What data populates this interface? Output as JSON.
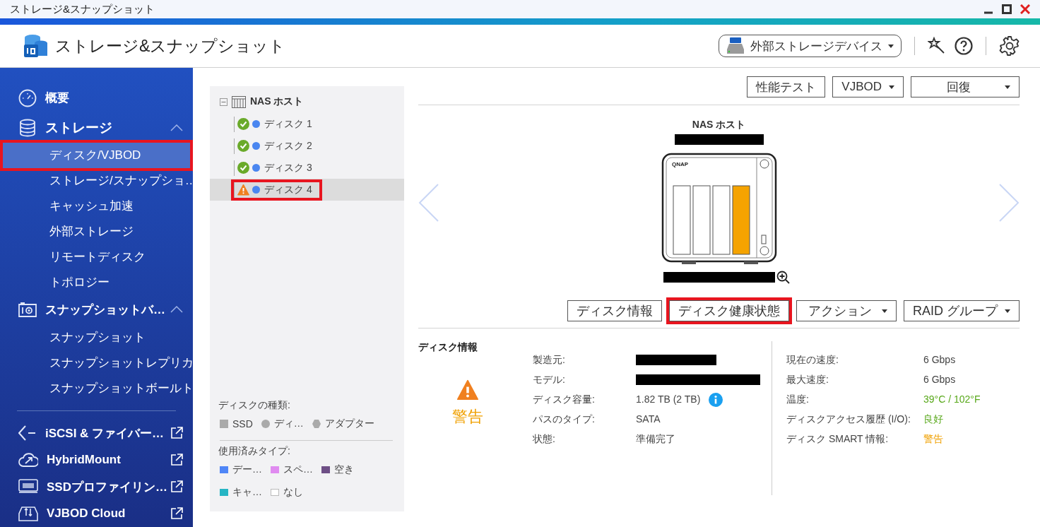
{
  "window": {
    "title": "ストレージ&スナップショット"
  },
  "header": {
    "app_title": "ストレージ&スナップショット",
    "device_selector": "外部ストレージデバイス"
  },
  "sidebar": {
    "sections": [
      {
        "label": "概要"
      },
      {
        "label": "ストレージ",
        "expanded": true,
        "children": [
          {
            "label": "ディスク/VJBOD",
            "selected": true,
            "highlighted": true
          },
          {
            "label": "ストレージ/スナップショ…",
            "selected": false,
            "highlighted": false
          },
          {
            "label": "キャッシュ加速",
            "selected": false,
            "highlighted": false
          },
          {
            "label": "外部ストレージ",
            "selected": false,
            "highlighted": false
          },
          {
            "label": "リモートディスク",
            "selected": false,
            "highlighted": false
          },
          {
            "label": "トポロジー",
            "selected": false,
            "highlighted": false
          }
        ]
      },
      {
        "label": "スナップショットバ…",
        "expanded": true,
        "children": [
          {
            "label": "スナップショット",
            "selected": false,
            "highlighted": false
          },
          {
            "label": "スナップショットレプリカ",
            "selected": false,
            "highlighted": false
          },
          {
            "label": "スナップショットボールト",
            "selected": false,
            "highlighted": false
          }
        ]
      }
    ],
    "external_links": [
      {
        "label": "iSCSI & ファイバー…"
      },
      {
        "label": "HybridMount"
      },
      {
        "label": "SSDプロファイリン…"
      },
      {
        "label": "VJBOD Cloud"
      }
    ]
  },
  "tree": {
    "label": "NAS ホスト",
    "expanded": true,
    "children": [
      {
        "label": "ディスク 1",
        "warning": false,
        "selected": false,
        "highlighted": false
      },
      {
        "label": "ディスク 2",
        "warning": false,
        "selected": false,
        "highlighted": false
      },
      {
        "label": "ディスク 3",
        "warning": false,
        "selected": false,
        "highlighted": false
      },
      {
        "label": "ディスク 4",
        "warning": true,
        "selected": true,
        "highlighted": true
      }
    ]
  },
  "legend": {
    "disk_types_title": "ディスクの種類:",
    "disk_types": [
      {
        "label": "SSD",
        "kind": "square"
      },
      {
        "label": "ディ…",
        "kind": "circle"
      },
      {
        "label": "アダプター",
        "kind": "hexagon"
      }
    ],
    "usage_types_title": "使用済みタイプ:",
    "usage_types": [
      {
        "label": "デー…",
        "color": "#4f86f7"
      },
      {
        "label": "スペ…",
        "color": "#e08bf0"
      },
      {
        "label": "空き",
        "color": "#6e4f86"
      },
      {
        "label": "キャ…",
        "color": "#26b5c4"
      },
      {
        "label": "なし",
        "color": "#ffffff"
      }
    ]
  },
  "toolbar": [
    {
      "label": "性能テスト",
      "kind": "button"
    },
    {
      "label": "VJBOD",
      "kind": "dropdown"
    },
    {
      "label": "回復",
      "kind": "dropdown"
    }
  ],
  "device": {
    "title": "NAS ホスト",
    "brand": "QNAP",
    "slots": [
      {
        "warning": false
      },
      {
        "warning": false
      },
      {
        "warning": false
      },
      {
        "warning": true
      }
    ]
  },
  "actions": [
    {
      "label": "ディスク情報",
      "kind": "button",
      "highlighted": false
    },
    {
      "label": "ディスク健康状態",
      "kind": "button",
      "highlighted": true
    },
    {
      "label": "アクション",
      "kind": "dropdown",
      "highlighted": false
    },
    {
      "label": "RAID グループ",
      "kind": "dropdown",
      "highlighted": false
    }
  ],
  "disk_info": {
    "heading": "ディスク情報",
    "status": {
      "label": "警告",
      "kind": "warning"
    },
    "left_fields": [
      {
        "label": "製造元:",
        "redacted": true
      },
      {
        "label": "モデル:",
        "redacted": true
      },
      {
        "label": "ディスク容量:",
        "value": "1.82 TB (2 TB)",
        "info": true
      },
      {
        "label": "パスのタイプ:",
        "value": "SATA"
      },
      {
        "label": "状態:",
        "value": "準備完了"
      }
    ],
    "right_fields": [
      {
        "label": "現在の速度:",
        "value": "6 Gbps"
      },
      {
        "label": "最大速度:",
        "value": "6 Gbps"
      },
      {
        "label": "温度:",
        "value": "39°C / 102°F",
        "color": "#58a81a"
      },
      {
        "label": "ディスクアクセス履歴 (I/O):",
        "value": "良好",
        "color": "#58a81a"
      },
      {
        "label": "ディスク SMART 情報:",
        "value": "警告",
        "color": "#f0a000"
      }
    ]
  }
}
